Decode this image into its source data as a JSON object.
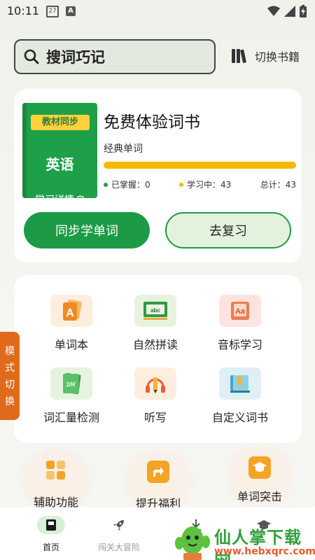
{
  "status": {
    "time": "10:11",
    "calendar_day": "27",
    "notification_letter": "A"
  },
  "search": {
    "placeholder": "搜词巧记"
  },
  "switch_book": {
    "label": "切换书籍"
  },
  "book_card": {
    "badge": "教材同步",
    "subject": "英语",
    "detail": "学习详情",
    "title": "免费体验词书",
    "subtitle": "经典单词",
    "progress_fraction": 0.0,
    "stats": [
      {
        "label": "已掌握：0",
        "color": "#1ea04a"
      },
      {
        "label": "学习中：43",
        "color": "#f6b900"
      },
      {
        "label": "总计：43",
        "color": ""
      }
    ],
    "primary_button": "同步学单词",
    "secondary_button": "去复习"
  },
  "features": [
    {
      "label": "单词本",
      "icon": "letter-a-card-icon"
    },
    {
      "label": "自然拼读",
      "icon": "abc-board-icon"
    },
    {
      "label": "音标学习",
      "icon": "aa-card-icon"
    },
    {
      "label": "词汇量检测",
      "icon": "test-book-icon"
    },
    {
      "label": "听写",
      "icon": "pencil-headphones-icon"
    },
    {
      "label": "自定义词书",
      "icon": "open-book-icon"
    }
  ],
  "side_tab": {
    "chars": [
      "模",
      "式",
      "切",
      "换"
    ]
  },
  "tools": [
    {
      "label": "辅助功能",
      "icon": "grid-icon"
    },
    {
      "label": "提升福利",
      "icon": "share-icon"
    },
    {
      "label": "单词突击",
      "icon": "graduation-cap-icon"
    }
  ],
  "bottom_nav": [
    {
      "label": "首页",
      "active": true
    },
    {
      "label": "闯关大冒险",
      "active": false
    },
    {
      "label": "",
      "active": false
    },
    {
      "label": "",
      "active": false
    }
  ],
  "watermark": {
    "title": "仙人掌下载网",
    "url": "www.hebxqrc.com"
  },
  "colors": {
    "brand_green": "#1d9a45",
    "accent_yellow": "#f6b900",
    "side_tab_orange": "#e06a1c"
  }
}
